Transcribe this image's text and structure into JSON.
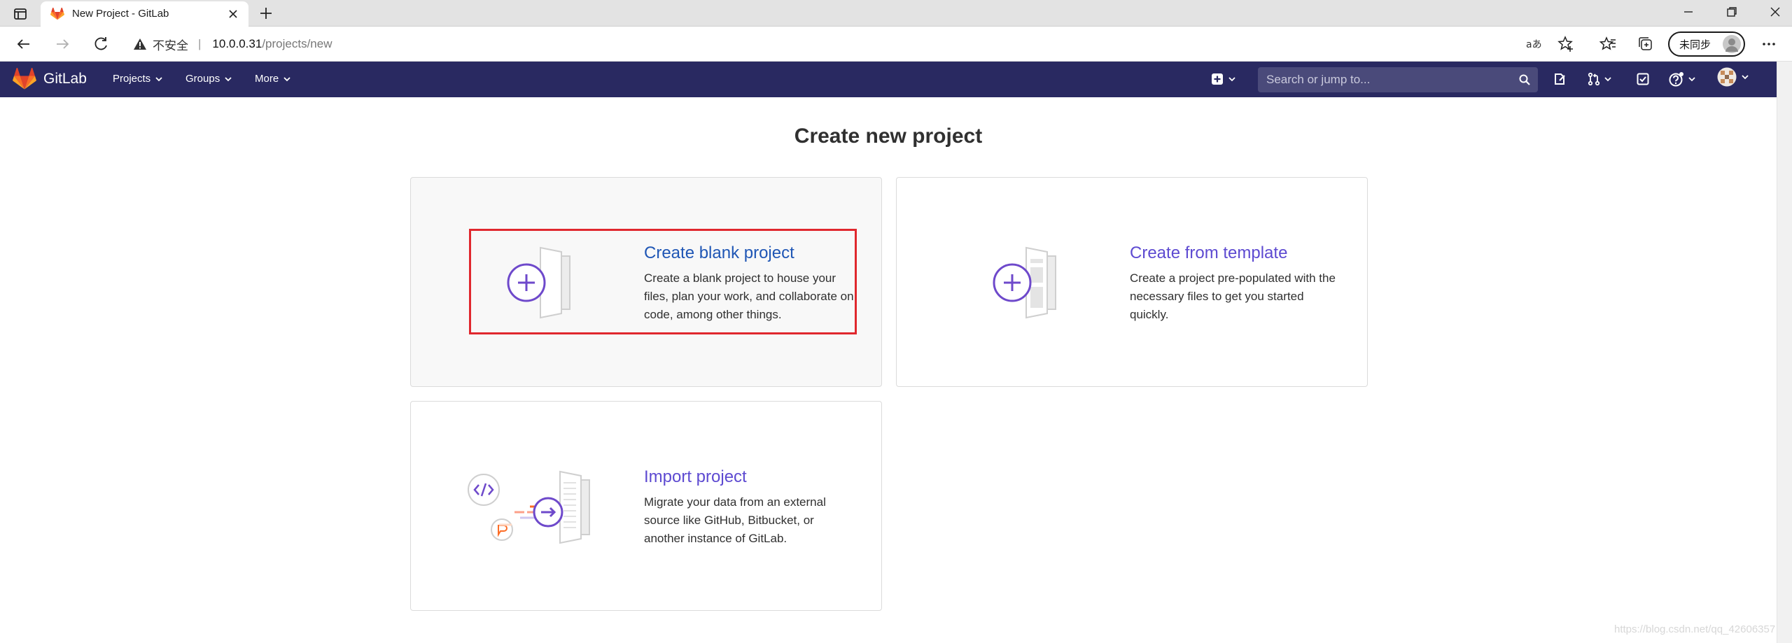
{
  "browser": {
    "tab_title": "New Project - GitLab",
    "address": {
      "security_label": "不安全",
      "separator": "|",
      "host": "10.0.0.31",
      "path": "/projects/new"
    },
    "sync_label": "未同步"
  },
  "navbar": {
    "brand": "GitLab",
    "menus": [
      "Projects",
      "Groups",
      "More"
    ],
    "search_placeholder": "Search or jump to..."
  },
  "main": {
    "title": "Create new project",
    "panels": [
      {
        "title": "Create blank project",
        "description": "Create a blank project to house your files, plan your work, and collaborate on code, among other things."
      },
      {
        "title": "Create from template",
        "description": "Create a project pre-populated with the necessary files to get you started quickly."
      },
      {
        "title": "Import project",
        "description": "Migrate your data from an external source like GitHub, Bitbucket, or another instance of GitLab."
      }
    ]
  },
  "watermark": "https://blog.csdn.net/qq_42606357",
  "colors": {
    "navbar": "#292961",
    "accent": "#5d4ad1",
    "highlight": "#e0282e",
    "orange": "#fc6d26"
  }
}
